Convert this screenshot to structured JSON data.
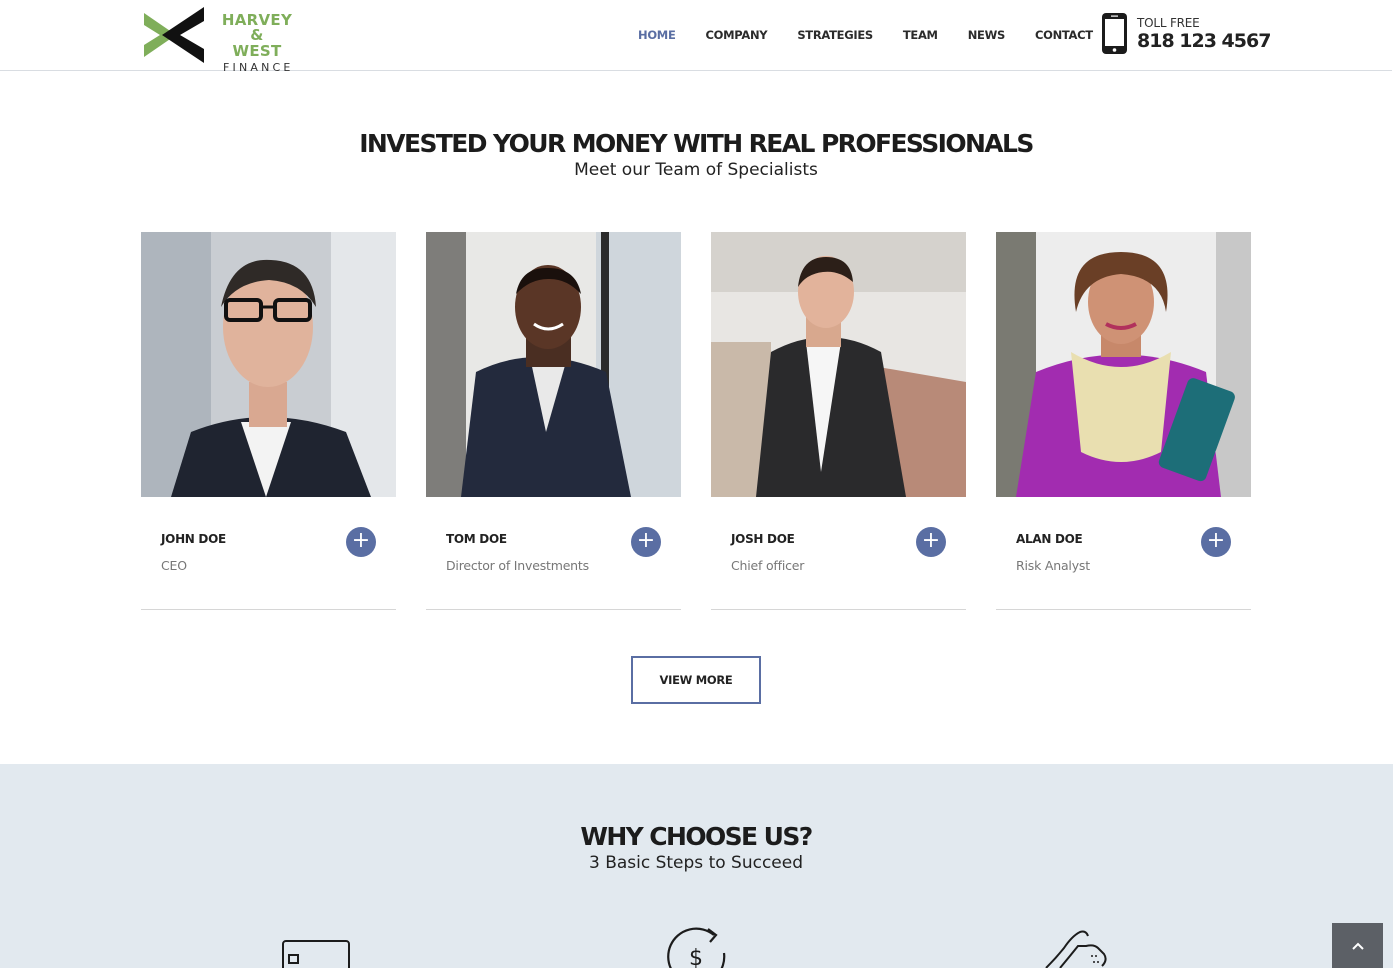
{
  "header": {
    "logo": {
      "line1": "HARVEY &",
      "line2": "WEST",
      "line3": "FINANCE"
    },
    "nav": [
      {
        "label": "HOME",
        "active": true
      },
      {
        "label": "COMPANY",
        "active": false
      },
      {
        "label": "STRATEGIES",
        "active": false
      },
      {
        "label": "TEAM",
        "active": false
      },
      {
        "label": "NEWS",
        "active": false
      },
      {
        "label": "CONTACT",
        "active": false
      }
    ],
    "phone": {
      "toll_label": "TOLL FREE",
      "number": "818 123 4567",
      "icon": "mobile-phone-icon"
    }
  },
  "team_section": {
    "title": "INVESTED YOUR MONEY WITH REAL PROFESSIONALS",
    "subtitle": "Meet our Team of Specialists",
    "members": [
      {
        "name": "JOHN DOE",
        "role": "CEO"
      },
      {
        "name": "TOM DOE",
        "role": "Director of Investments"
      },
      {
        "name": "JOSH DOE",
        "role": "Chief officer"
      },
      {
        "name": "ALAN DOE",
        "role": "Risk Analyst"
      }
    ],
    "plus_label": "+",
    "view_more": "VIEW MORE"
  },
  "why_section": {
    "title": "WHY CHOOSE US?",
    "subtitle": "3 Basic Steps to Succeed",
    "icons": [
      "credit-card-icon",
      "dollar-cycle-icon",
      "handshake-icon"
    ]
  },
  "scroll_top": {
    "icon": "chevron-up-icon",
    "label": "^"
  },
  "colors": {
    "accent": "#5a6ea3",
    "logo_green": "#7fae5a",
    "why_bg": "#e2e9ef"
  }
}
